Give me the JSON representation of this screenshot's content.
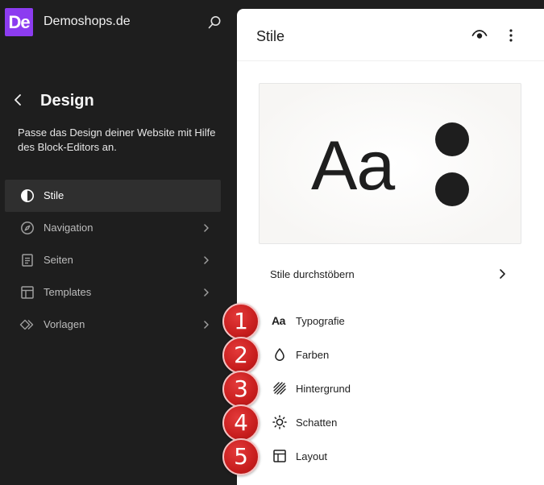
{
  "site": {
    "logo_text": "De",
    "name": "Demoshops.de"
  },
  "sidebar": {
    "title": "Design",
    "description": "Passe das Design deiner Website mit Hilfe des Block-Editors an.",
    "items": [
      {
        "label": "Stile",
        "icon": "half-circle-icon",
        "active": true,
        "has_chevron": false
      },
      {
        "label": "Navigation",
        "icon": "compass-icon",
        "active": false,
        "has_chevron": true
      },
      {
        "label": "Seiten",
        "icon": "page-icon",
        "active": false,
        "has_chevron": true
      },
      {
        "label": "Templates",
        "icon": "layout-icon",
        "active": false,
        "has_chevron": true
      },
      {
        "label": "Vorlagen",
        "icon": "symbol-icon",
        "active": false,
        "has_chevron": true
      }
    ]
  },
  "panel": {
    "title": "Stile",
    "preview": {
      "sample_text": "Aa"
    },
    "browse_label": "Stile durchstöbern",
    "menu": [
      {
        "label": "Typografie",
        "icon": "typography-icon",
        "icon_text": "Aa"
      },
      {
        "label": "Farben",
        "icon": "droplet-icon"
      },
      {
        "label": "Hintergrund",
        "icon": "background-icon"
      },
      {
        "label": "Schatten",
        "icon": "shadow-sun-icon"
      },
      {
        "label": "Layout",
        "icon": "layout-icon"
      }
    ]
  },
  "badges": [
    "1",
    "2",
    "3",
    "4",
    "5"
  ],
  "colors": {
    "sidebar_bg": "#1e1e1e",
    "active_item_bg": "#2f2f2f",
    "logo_bg": "#8c3cf0",
    "badge_red": "#c81e1e",
    "panel_bg": "#ffffff"
  }
}
